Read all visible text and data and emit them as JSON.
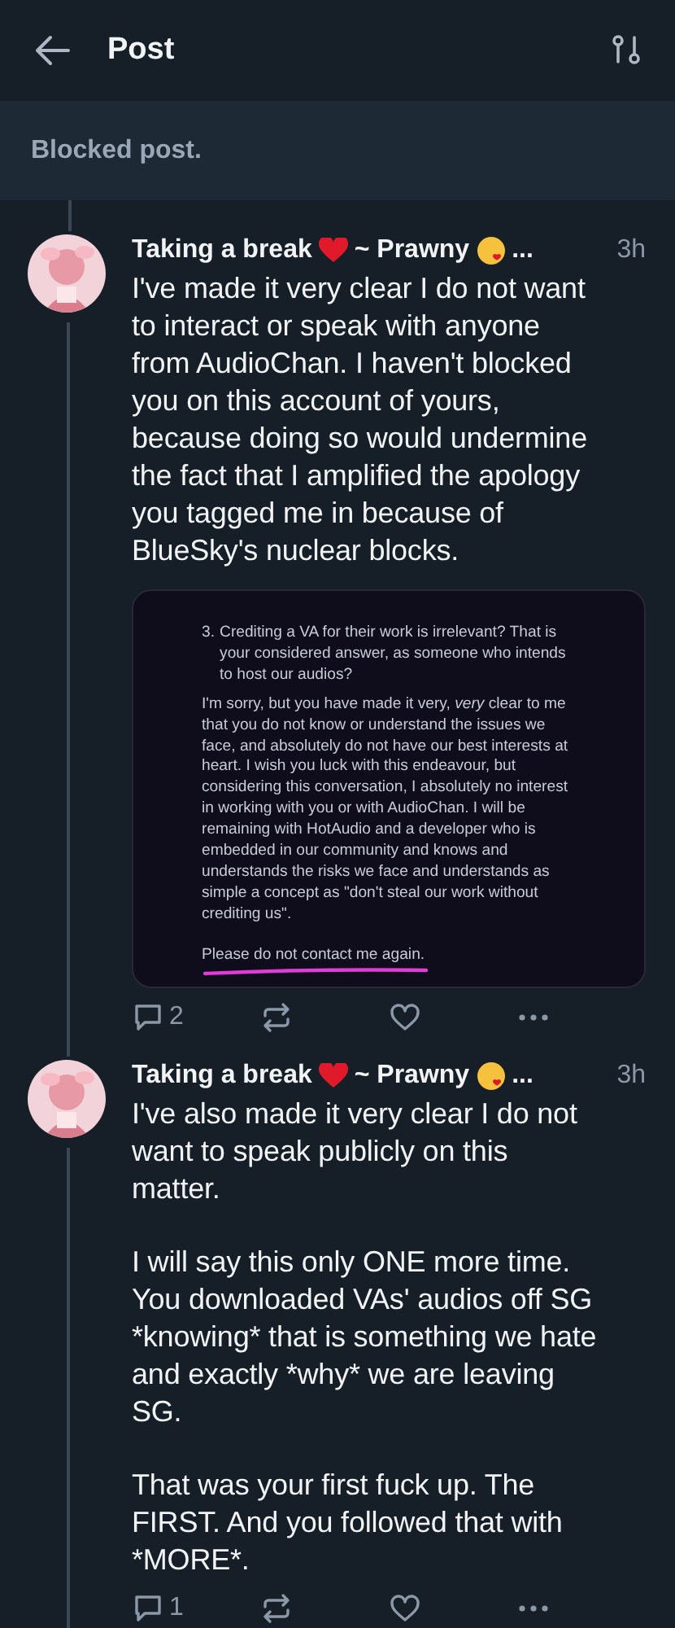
{
  "header": {
    "title": "Post"
  },
  "blocked_notice": "Blocked post.",
  "posts": [
    {
      "author": [
        {
          "kind": "text",
          "text": "Taking a break"
        },
        {
          "kind": "heart"
        },
        {
          "kind": "text",
          "text": "~ Prawny"
        },
        {
          "kind": "kiss"
        },
        {
          "kind": "text",
          "text": "..."
        }
      ],
      "time": "3h",
      "paragraphs": [
        "I've made it very clear I do not want to interact or speak with anyone from AudioChan. I haven't blocked you on this account of yours, because doing so would undermine the fact that I amplified the apology you tagged me in because of BlueSky's nuclear blocks."
      ],
      "attachment": {
        "list_number": "3.",
        "list_text": "Crediting a VA for their work is irrelevant? That is your considered answer, as someone who intends to host our audios?",
        "body": "I'm sorry, but you have made it very, *very* clear to me that you do not know or understand the issues we face, and absolutely do not have our best interests at heart. I wish you luck with this endeavour, but considering this conversation, I absolutely no interest in working with you or with AudioChan. I will be remaining with HotAudio and a developer who is embedded in our community and knows and understands the risks we face and understands as simple a concept as \"don't steal our work without crediting us\".",
        "closing": "Please do not contact me again."
      },
      "replies": "2"
    },
    {
      "author": [
        {
          "kind": "text",
          "text": "Taking a break"
        },
        {
          "kind": "heart"
        },
        {
          "kind": "text",
          "text": "~ Prawny"
        },
        {
          "kind": "kiss"
        },
        {
          "kind": "text",
          "text": "..."
        }
      ],
      "time": "3h",
      "paragraphs": [
        "I've also made it very clear I do not want to speak publicly on this matter.",
        "I will say this only ONE more time. You downloaded VAs' audios off SG *knowing* that is something we hate and exactly *why* we are leaving SG.",
        "That was your first fuck up. The FIRST. And you followed that with *MORE*."
      ],
      "replies": "1"
    }
  ]
}
